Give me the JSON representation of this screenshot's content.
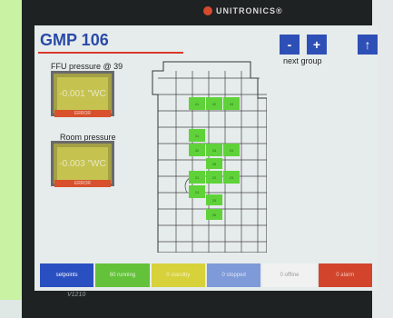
{
  "brand": {
    "name": "UNITRONICS®"
  },
  "device": {
    "model": "V1210"
  },
  "screen": {
    "title": "GMP 106",
    "nav": {
      "minus": "-",
      "plus": "+",
      "up": "↑",
      "label": "next group"
    },
    "ffu": {
      "label": "FFU pressure @ 39",
      "value": "-0.001 \"WC",
      "status": "ERROR"
    },
    "room": {
      "label": "Room pressure",
      "value": "-0.003 \"WC",
      "status": "ERROR"
    },
    "plan": {
      "units": [
        "41",
        "42",
        "43",
        "31",
        "32",
        "33",
        "34",
        "35",
        "21",
        "22",
        "23",
        "24",
        "25",
        "26"
      ]
    },
    "legend": {
      "setpoints": "setpoints",
      "running": "60 running",
      "standby": "0 standby",
      "stopped": "0 stopped",
      "offline": "0 offline",
      "alarm": "0 alarm"
    }
  },
  "colors": {
    "title": "#2a4aa8",
    "running": "#63c23a",
    "alarm": "#d2452c",
    "standby": "#d7d13a",
    "stopped": "#7f9ad8"
  }
}
